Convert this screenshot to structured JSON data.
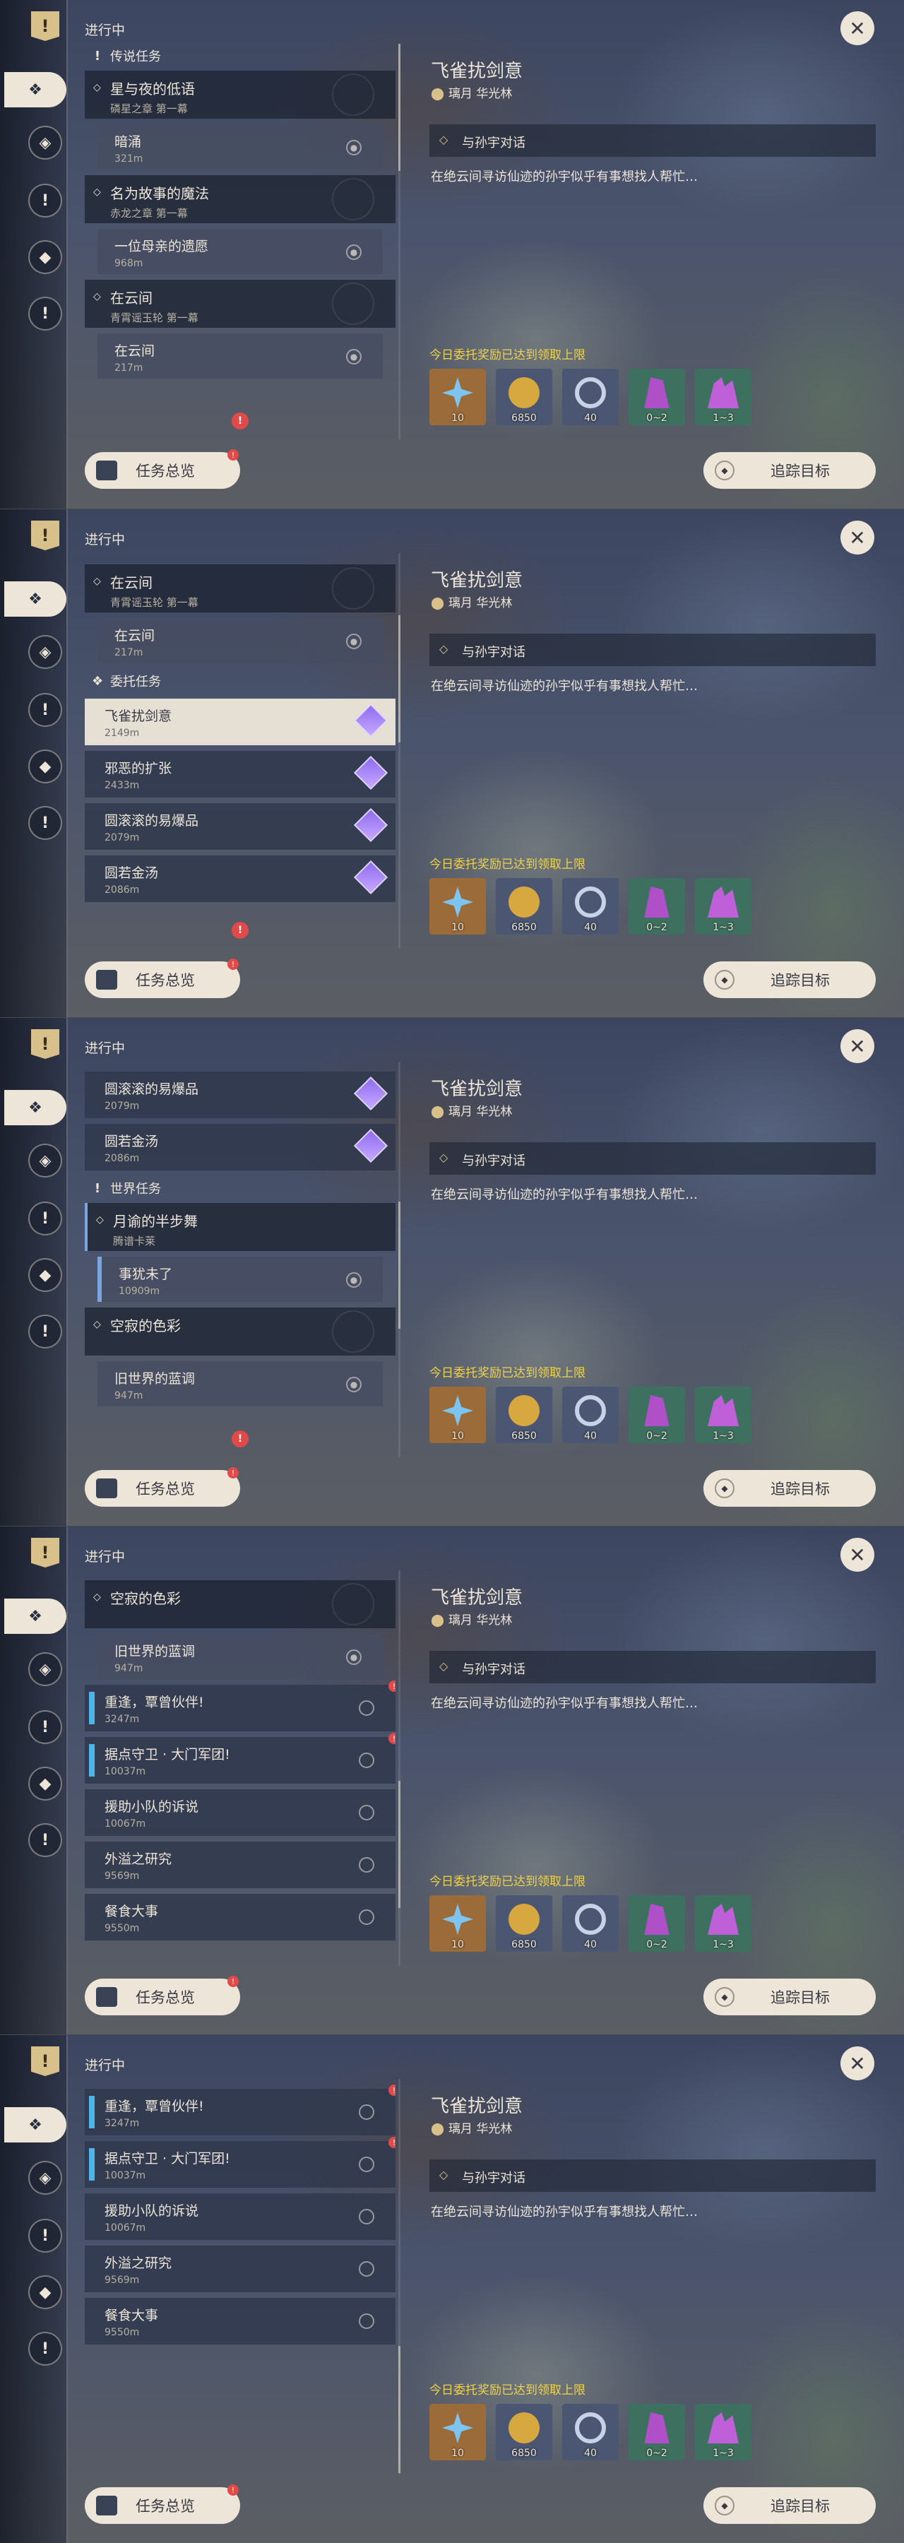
{
  "header": {
    "in_progress": "进行中"
  },
  "detail": {
    "title": "飞雀扰剑意",
    "location": "璃月 华光林",
    "objective": "与孙宇对话",
    "description": "在绝云间寻访仙迹的孙宇似乎有事想找人帮忙…",
    "reward_note": "今日委托奖励已达到领取上限",
    "rewards": [
      {
        "icon": "adventure-exp-icon",
        "value": "10"
      },
      {
        "icon": "mora-coin-icon",
        "value": "6850"
      },
      {
        "icon": "friendship-exp-icon",
        "value": "40"
      },
      {
        "icon": "green-crystal-icon",
        "value": "0~2"
      },
      {
        "icon": "purple-crystal-icon",
        "value": "1~3"
      }
    ]
  },
  "buttons": {
    "overview": "任务总览",
    "track": "追踪目标",
    "close": "✕"
  },
  "sections": {
    "legend": "传说任务",
    "commission": "委托任务",
    "world": "世界任务"
  },
  "quests": {
    "star_night": {
      "name": "星与夜的低语",
      "sub": "磷星之章 第一幕",
      "step": "暗涌",
      "dist": "321m"
    },
    "story_magic": {
      "name": "名为故事的魔法",
      "sub": "赤龙之章 第一幕",
      "step": "一位母亲的遗愿",
      "dist": "968m"
    },
    "cloud": {
      "name": "在云间",
      "sub": "青霄谣玉轮 第一幕",
      "step": "在云间",
      "dist": "217m"
    },
    "moon_dance": {
      "name": "月谕的半步舞",
      "sub": "腾谱卡莱",
      "step": "事犹未了",
      "dist": "10909m"
    },
    "lonely_color": {
      "name": "空寂的色彩",
      "step": "旧世界的蓝调",
      "dist": "947m"
    }
  },
  "commissions": [
    {
      "name": "飞雀扰剑意",
      "dist": "2149m"
    },
    {
      "name": "邪恶的扩张",
      "dist": "2433m"
    },
    {
      "name": "圆滚滚的易爆品",
      "dist": "2079m"
    },
    {
      "name": "圆若金汤",
      "dist": "2086m"
    }
  ],
  "world_rows": [
    {
      "name": "重逢，覃曾伙伴!",
      "dist": "3247m"
    },
    {
      "name": "据点守卫 · 大门军团!",
      "dist": "10037m"
    },
    {
      "name": "援助小队的诉说",
      "dist": "10067m"
    },
    {
      "name": "外溢之研究",
      "dist": "9569m"
    },
    {
      "name": "餐食大事",
      "dist": "9550m"
    }
  ],
  "badge": "!"
}
